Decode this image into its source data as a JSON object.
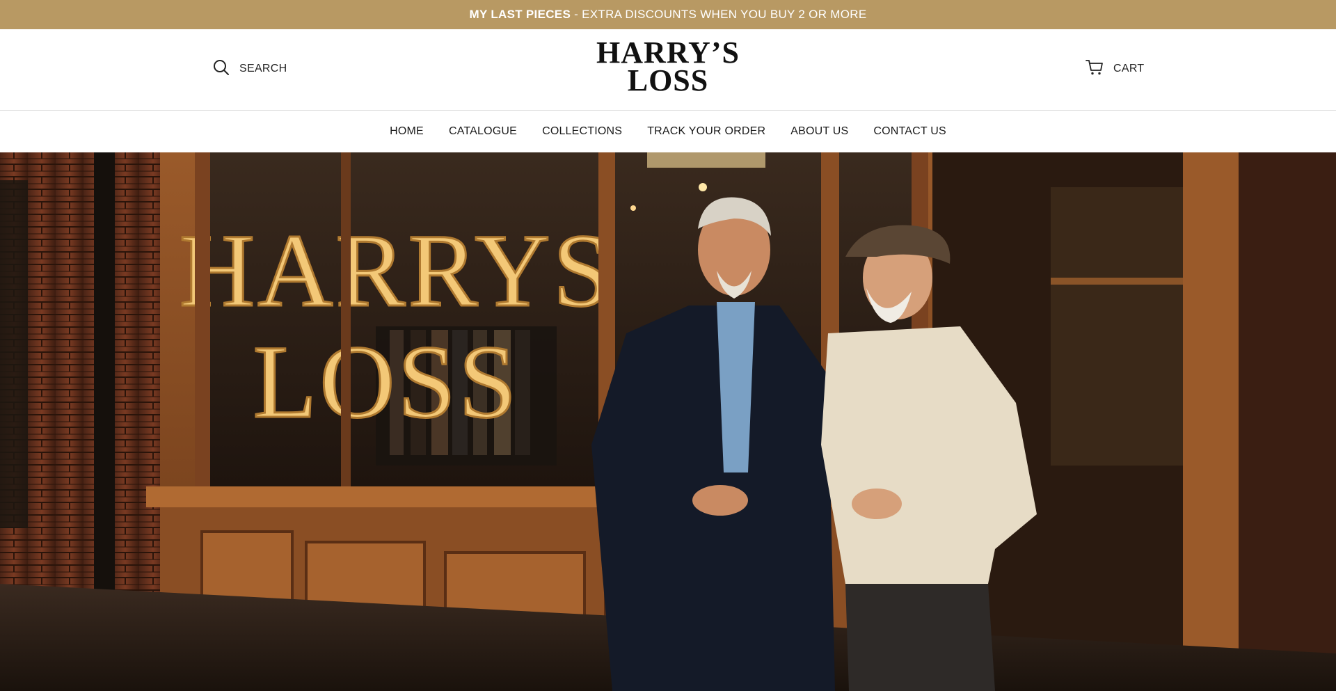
{
  "announcement": {
    "strong": "MY LAST PIECES",
    "rest": " - EXTRA DISCOUNTS WHEN YOU BUY 2 OR MORE"
  },
  "header": {
    "search_label": "SEARCH",
    "search_icon": "search-icon",
    "logo_line1": "HARRY’S",
    "logo_line2": "LOSS",
    "cart_label": "CART",
    "cart_icon": "cart-icon"
  },
  "nav": {
    "items": [
      {
        "label": "HOME"
      },
      {
        "label": "CATALOGUE"
      },
      {
        "label": "COLLECTIONS"
      },
      {
        "label": "TRACK YOUR ORDER"
      },
      {
        "label": "ABOUT US"
      },
      {
        "label": "CONTACT US"
      }
    ]
  },
  "hero": {
    "window_sign_line1": "HARRYS",
    "window_sign_line2": "LOSS"
  },
  "colors": {
    "announcement_bg": "#b89963",
    "sign_gold": "#f3c877"
  }
}
